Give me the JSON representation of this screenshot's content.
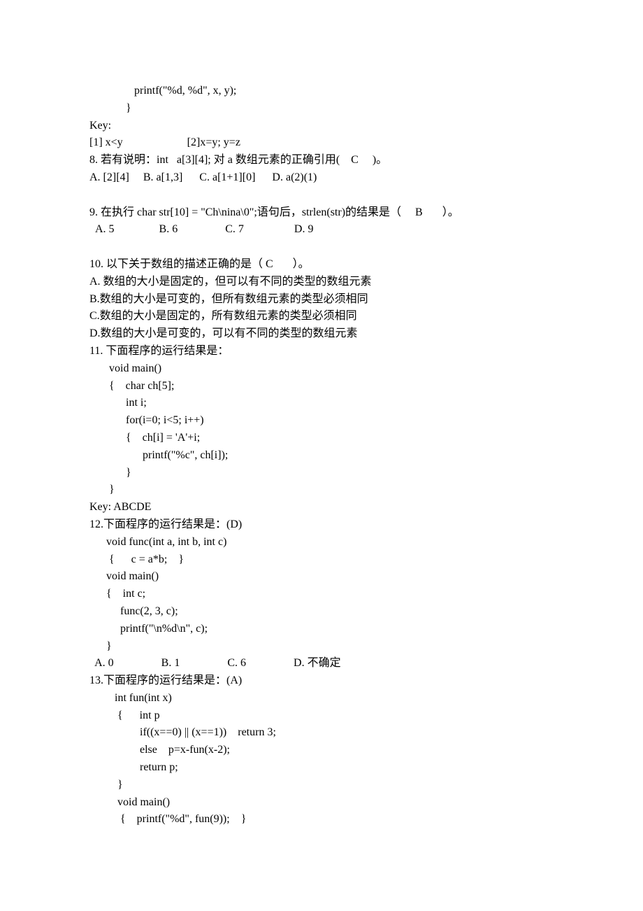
{
  "lines": {
    "l01": "                printf(\"%d, %d\", x, y);",
    "l02": "             }",
    "l03": "Key:",
    "l04": "[1] x<y                       [2]x=y; y=z",
    "l05": "8. 若有说明：int   a[3][4]; 对 a 数组元素的正确引用(    C     )。",
    "l06": "A. [2][4]     B. a[1,3]      C. a[1+1][0]      D. a(2)(1)",
    "l07": "",
    "l08": "9. 在执行 char str[10] = \"Ch\\nina\\0\";语句后，strlen(str)的结果是（     B       ）。",
    "l09": "  A. 5                B. 6                 C. 7                  D. 9",
    "l10": "",
    "l11": "10. 以下关于数组的描述正确的是（ C       ）。",
    "l12": "A. 数组的大小是固定的，但可以有不同的类型的数组元素",
    "l13": "B.数组的大小是可变的，但所有数组元素的类型必须相同",
    "l14": "C.数组的大小是固定的，所有数组元素的类型必须相同",
    "l15": "D.数组的大小是可变的，可以有不同的类型的数组元素",
    "l16": "11. 下面程序的运行结果是：",
    "l17": "       void main()",
    "l18": "       {    char ch[5];",
    "l19": "             int i;",
    "l20": "             for(i=0; i<5; i++)",
    "l21": "             {    ch[i] = 'A'+i;",
    "l22": "                   printf(\"%c\", ch[i]);",
    "l23": "             }",
    "l24": "       }",
    "l25": "Key: ABCDE",
    "l26": "12.下面程序的运行结果是：(D)",
    "l27": "      void func(int a, int b, int c)",
    "l28": "       {      c = a*b;    }",
    "l29": "      void main()",
    "l30": "      {    int c;",
    "l31": "           func(2, 3, c);",
    "l32": "           printf(\"\\n%d\\n\", c);",
    "l33": "      }",
    "l34": "  A. 0                 B. 1                 C. 6                 D. 不确定",
    "l35": "13.下面程序的运行结果是：(A)",
    "l36": "         int fun(int x)",
    "l37": "          {      int p",
    "l38": "                  if((x==0) || (x==1))    return 3;",
    "l39": "                  else    p=x-fun(x-2);",
    "l40": "                  return p;",
    "l41": "          }",
    "l42": "          void main()",
    "l43": "           {    printf(\"%d\", fun(9));    }"
  }
}
